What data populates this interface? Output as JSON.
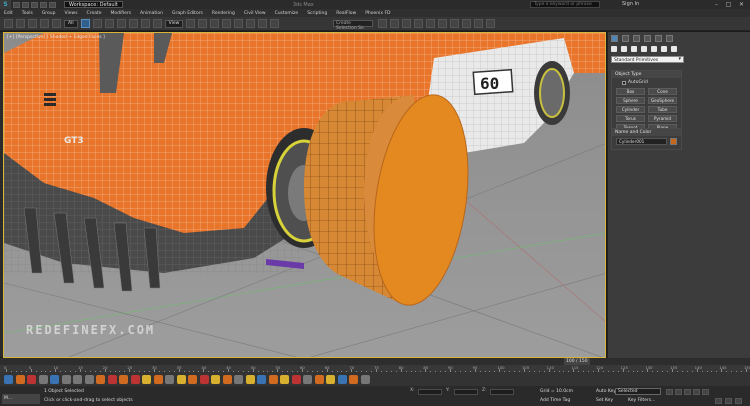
{
  "titlebar": {
    "logo": "S",
    "workspace": "Workspace: Default",
    "app_title": "3ds Max",
    "search_placeholder": "Type a keyword or phrase",
    "signin": "Sign In",
    "minimize": "–",
    "maximize": "□",
    "close": "✕"
  },
  "menu": [
    "Edit",
    "Tools",
    "Group",
    "Views",
    "Create",
    "Modifiers",
    "Animation",
    "Graph Editors",
    "Rendering",
    "Civil View",
    "Customize",
    "Scripting",
    "RealFlow",
    "Phoenix FD"
  ],
  "toolbar": {
    "filter": "All",
    "ref_coord": "View",
    "named_selection": "Create Selection Se"
  },
  "viewport": {
    "label": "[+] [Perspective] [ Shaded + Edged Faces ]",
    "watermark": "REDEFINEFX.COM",
    "car_number": "60",
    "car_badge": "GT3"
  },
  "command_panel": {
    "category_dropdown": "Standard Primitives",
    "object_type_title": "Object Type",
    "autogrid_label": "AutoGrid",
    "object_types": [
      "Box",
      "Cone",
      "Sphere",
      "GeoSphere",
      "Cylinder",
      "Tube",
      "Torus",
      "Pyramid",
      "Teapot",
      "Plane"
    ],
    "name_color_title": "Name and Color",
    "object_name": "Cylinder001",
    "object_color": "#c7671e"
  },
  "timeline": {
    "frame_label": "100 / 150",
    "ticks": [
      "0",
      "5",
      "10",
      "15",
      "20",
      "25",
      "30",
      "35",
      "40",
      "45",
      "50",
      "55",
      "60",
      "65",
      "70",
      "75",
      "80",
      "85",
      "90",
      "95",
      "100",
      "105",
      "110",
      "115",
      "120",
      "125",
      "130",
      "135",
      "140",
      "145",
      "150"
    ]
  },
  "status": {
    "taskbar_item": "M...",
    "line1": "1 Object Selected",
    "line2": "Click or click-and-drag to select objects",
    "x_label": "X:",
    "y_label": "Y:",
    "z_label": "Z:",
    "grid": "Grid = 10.0cm",
    "add_time_tag": "Add Time Tag",
    "auto_key": "Auto Key",
    "set_key": "Set Key",
    "selected_dropdown": "Selected",
    "key_filters": "Key Filters..."
  }
}
